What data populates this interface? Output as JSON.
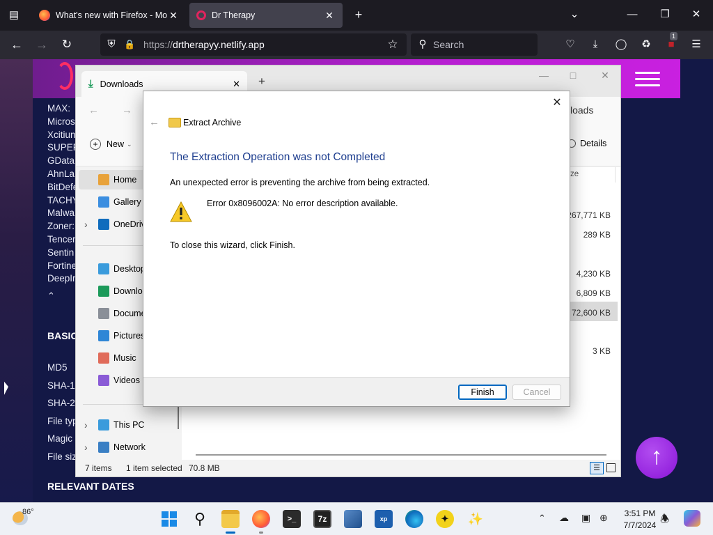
{
  "browser": {
    "tabs": [
      {
        "title": "What's new with Firefox - More"
      },
      {
        "title": "Dr Therapy"
      }
    ],
    "url_scheme": "https://",
    "url_host": "drtherapyy.netlify.app",
    "search_placeholder": "Search",
    "extension_badge": "1"
  },
  "website": {
    "list_items": [
      "MAX:",
      "Micros",
      "Xcitiun",
      "SUPER",
      "GData",
      "AhnLa",
      "BitDefe",
      "TACHY",
      "Malwa",
      "Zoner:",
      "Tencer",
      "Sentin",
      "Fortine",
      "DeepIr"
    ],
    "heading_basic": "BASIC",
    "basic_items": [
      "MD5",
      "SHA-1",
      "SHA-2",
      "File typ",
      "Magic",
      "File siz"
    ],
    "heading_dates": "RELEVANT DATES"
  },
  "explorer": {
    "tab_title": "Downloads",
    "address_partial": "loads",
    "new_label": "New",
    "details_label": "Details",
    "column_size_partial": "ze",
    "nav_items": [
      {
        "label": "Home",
        "icon": "home-icon",
        "color": "#e8a23a"
      },
      {
        "label": "Gallery",
        "icon": "gallery-icon",
        "color": "#3b8ee0"
      },
      {
        "label": "OneDriv",
        "icon": "onedrive-icon",
        "color": "#0f6cbd"
      },
      {
        "label": "Desktop",
        "icon": "desktop-icon",
        "color": "#3a9bdc"
      },
      {
        "label": "Downlo",
        "icon": "download-icon",
        "color": "#1c9a5a"
      },
      {
        "label": "Docume",
        "icon": "documents-icon",
        "color": "#8a8f98"
      },
      {
        "label": "Pictures",
        "icon": "pictures-icon",
        "color": "#2f86d6"
      },
      {
        "label": "Music",
        "icon": "music-icon",
        "color": "#e06b5a"
      },
      {
        "label": "Videos",
        "icon": "videos-icon",
        "color": "#8a5bd6"
      },
      {
        "label": "This PC",
        "icon": "this-pc-icon",
        "color": "#3a9bdc"
      },
      {
        "label": "Network",
        "icon": "network-icon",
        "color": "#3a7fc4"
      }
    ],
    "file_sizes": [
      "267,771 KB",
      "289 KB",
      "4,230 KB",
      "6,809 KB",
      "72,600 KB",
      "3 KB"
    ],
    "status_items": "7 items",
    "status_selected": "1 item selected",
    "status_size": "70.8 MB"
  },
  "dialog": {
    "wizard_title": "Extract Archive",
    "heading": "The Extraction Operation was not Completed",
    "message": "An unexpected error is preventing the archive from being extracted.",
    "error_text": "Error 0x8096002A: No error description available.",
    "instruction": "To close this wizard, click Finish.",
    "finish_label": "Finish",
    "cancel_label": "Cancel"
  },
  "taskbar": {
    "weather_temp": "86°",
    "time": "3:51 PM",
    "date": "7/7/2024"
  },
  "colors": {
    "site_header": "#b520d0",
    "dialog_heading": "#1e3e8f",
    "finish_border": "#0067c0",
    "scroll_button": "#8a15d8"
  }
}
